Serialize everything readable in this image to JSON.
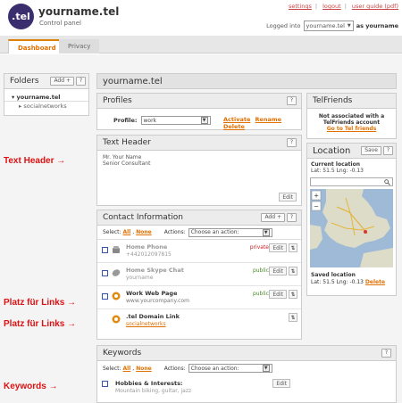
{
  "header": {
    "logo": ".tel",
    "title": "yourname.tel",
    "subtitle": "Control panel",
    "links": [
      "settings",
      "logout",
      "user guide (pdf)"
    ],
    "logged_in_prefix": "Logged into",
    "logged_in_account": "yourname.tel",
    "logged_in_as": "as yourname"
  },
  "tabs": [
    "Dashboard",
    "Privacy"
  ],
  "folders": {
    "title": "Folders",
    "add": "Add +",
    "help": "?",
    "items": [
      "yourname.tel",
      "socialnetworks"
    ]
  },
  "main_title": "yourname.tel",
  "profiles": {
    "title": "Profiles",
    "help": "?",
    "label": "Profile:",
    "selected": "work",
    "activate": "Activate",
    "rename": "Rename",
    "delete": "Delete"
  },
  "text_header": {
    "title": "Text Header",
    "help": "?",
    "lines": [
      "Mr. Your Name",
      "Senior Consultant"
    ],
    "edit": "Edit"
  },
  "contact": {
    "title": "Contact Information",
    "add": "Add +",
    "help": "?",
    "select_label": "Select:",
    "all": "All",
    "none": "None",
    "actions_label": "Actions:",
    "actions_placeholder": "Choose an action:",
    "rows": [
      {
        "title": "Home Phone",
        "value": "+442012097815",
        "visibility": "private",
        "edit": "Edit"
      },
      {
        "title": "Home Skype Chat",
        "value": "yourname",
        "visibility": "public",
        "edit": "Edit"
      },
      {
        "title": "Work Web Page",
        "value": "www.yourcompany.com",
        "visibility": "public",
        "edit": "Edit"
      },
      {
        "title": ".tel Domain Link",
        "value": "socialnetworks",
        "visibility": "",
        "edit": ""
      }
    ]
  },
  "keywords": {
    "title": "Keywords",
    "help": "?",
    "select_label": "Select:",
    "all": "All",
    "none": "None",
    "actions_label": "Actions:",
    "actions_placeholder": "Choose an action:",
    "row_title": "Hobbies & Interests:",
    "row_value": "Mountain biking, guitar, jazz",
    "edit": "Edit"
  },
  "telfriends": {
    "title": "TelFriends",
    "line1": "Not associated with a",
    "line2": "TelFriends account",
    "link": "Go to Tel friends"
  },
  "location": {
    "title": "Location",
    "save": "Save",
    "help": "?",
    "current_label": "Current location",
    "current_coords": "Lat: 51.5 Lng: -0.13",
    "saved_label": "Saved location",
    "saved_coords": "Lat: 51.5 Lng: -0.13",
    "delete": "Delete"
  },
  "annotations": [
    "Text Header →",
    "Platz für Links →",
    "Platz für Links →",
    "Keywords →"
  ]
}
